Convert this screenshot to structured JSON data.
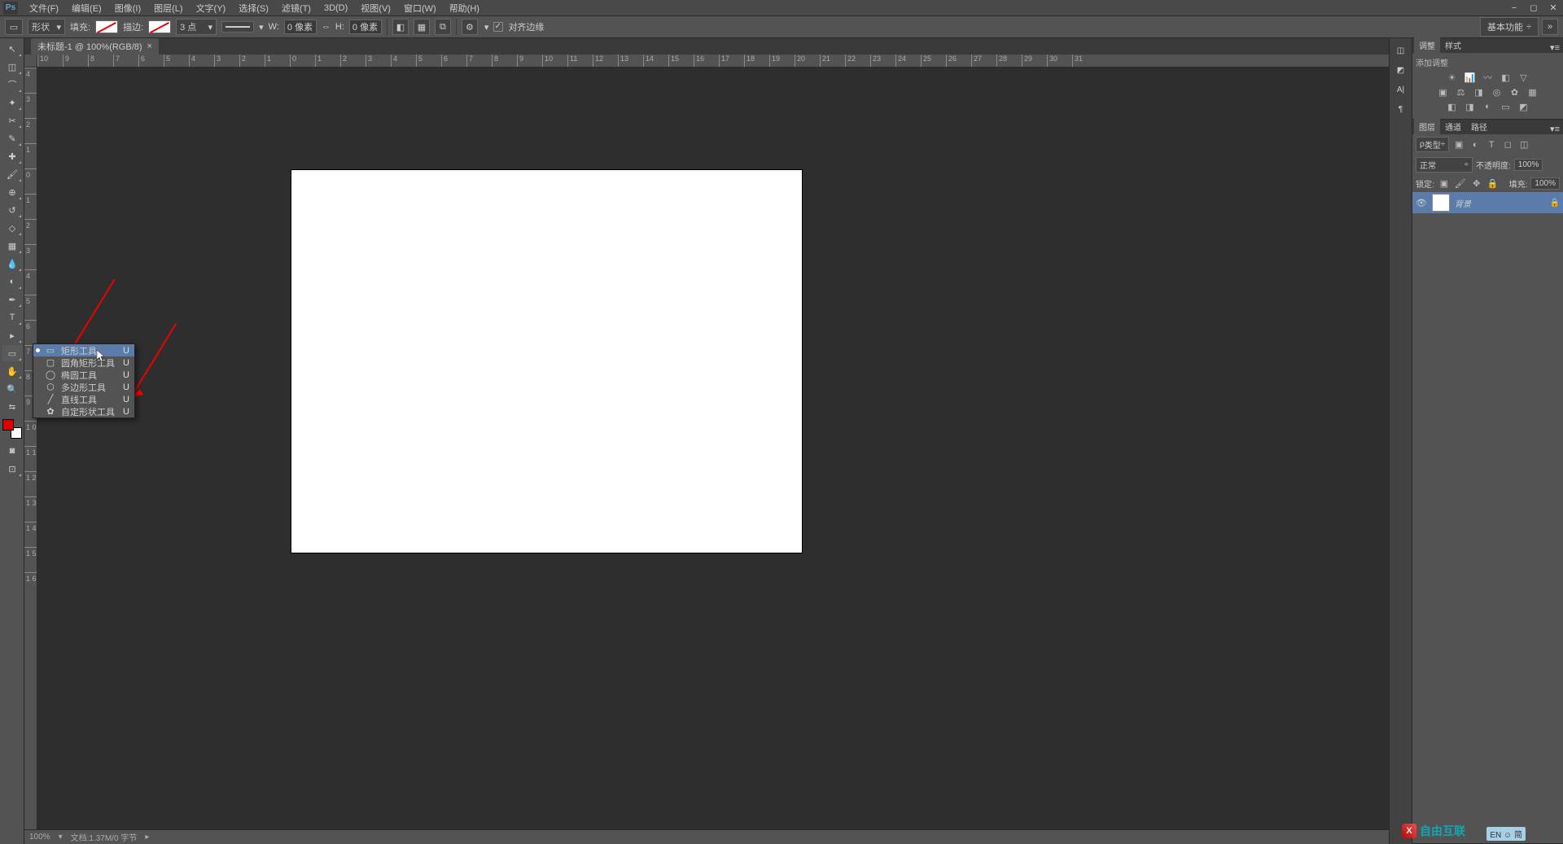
{
  "app": {
    "logo": "Ps"
  },
  "menu": {
    "items": [
      "文件(F)",
      "编辑(E)",
      "图像(I)",
      "图层(L)",
      "文字(Y)",
      "选择(S)",
      "滤镜(T)",
      "3D(D)",
      "视图(V)",
      "窗口(W)",
      "帮助(H)"
    ]
  },
  "options": {
    "mode_label": "形状",
    "fill_label": "填充:",
    "stroke_label": "描边:",
    "stroke_width": "3 点",
    "w_label": "W:",
    "w_value": "0 像素",
    "h_label": "H:",
    "h_value": "0 像素",
    "align_edges": "对齐边缘",
    "basic_functions": "基本功能"
  },
  "doc": {
    "tab_title": "未标题-1 @ 100%(RGB/8)",
    "zoom": "100%",
    "status_doc": "文档:1.37M/0 字节"
  },
  "ruler": {
    "horiz": [
      "10",
      "9",
      "8",
      "7",
      "6",
      "5",
      "4",
      "3",
      "2",
      "1",
      "0",
      "1",
      "2",
      "3",
      "4",
      "5",
      "6",
      "7",
      "8",
      "9",
      "10",
      "11",
      "12",
      "13",
      "14",
      "15",
      "16",
      "17",
      "18",
      "19",
      "20",
      "21",
      "22",
      "23",
      "24",
      "25",
      "26",
      "27",
      "28",
      "29",
      "30",
      "31"
    ],
    "vert": [
      "4",
      "3",
      "2",
      "1",
      "0",
      "1",
      "2",
      "3",
      "4",
      "5",
      "6",
      "7",
      "8",
      "9",
      "1 0",
      "1 1",
      "1 2",
      "1 3",
      "1 4",
      "1 5",
      "1 6"
    ]
  },
  "flyout": {
    "items": [
      {
        "label": "矩形工具",
        "key": "U",
        "selected": true,
        "icon": "▭"
      },
      {
        "label": "圆角矩形工具",
        "key": "U",
        "selected": false,
        "icon": "▢"
      },
      {
        "label": "椭圆工具",
        "key": "U",
        "selected": false,
        "icon": "◯"
      },
      {
        "label": "多边形工具",
        "key": "U",
        "selected": false,
        "icon": "⬡"
      },
      {
        "label": "直线工具",
        "key": "U",
        "selected": false,
        "icon": "╱"
      },
      {
        "label": "自定形状工具",
        "key": "U",
        "selected": false,
        "icon": "✿"
      }
    ]
  },
  "panels": {
    "adjust_tab": "调整",
    "style_tab": "样式",
    "add_adjust": "添加调整",
    "layers_tab": "图层",
    "channels_tab": "通道",
    "paths_tab": "路径",
    "type_filter": "类型",
    "blend_mode": "正常",
    "opacity_label": "不透明度:",
    "opacity_value": "100%",
    "lock_label": "锁定:",
    "fill_opacity_label": "填充:",
    "fill_opacity_value": "100%",
    "layer_name": "背景"
  },
  "watermark": {
    "text": "自由互联"
  },
  "ime": {
    "badge": "EN ☺ 简"
  }
}
